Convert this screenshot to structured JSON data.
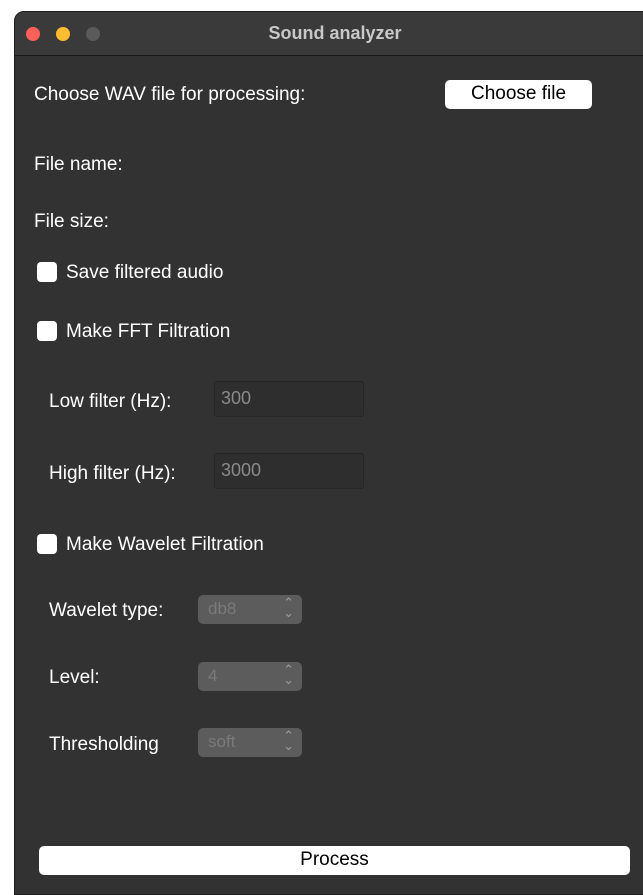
{
  "window": {
    "title": "Sound analyzer"
  },
  "file": {
    "choose_label": "Choose WAV file for processing:",
    "choose_button": "Choose file",
    "name_label": "File name:",
    "size_label": "File size:"
  },
  "options": {
    "save_filtered_label": "Save filtered audio",
    "save_filtered_checked": false,
    "fft_label": "Make FFT Filtration",
    "fft_checked": false
  },
  "fft": {
    "low_label": "Low filter (Hz):",
    "low_value": "300",
    "high_label": "High filter (Hz):",
    "high_value": "3000"
  },
  "wavelet": {
    "checkbox_label": "Make Wavelet Filtration",
    "checked": false,
    "type_label": "Wavelet type:",
    "type_value": "db8",
    "level_label": "Level:",
    "level_value": "4",
    "threshold_label": "Thresholding",
    "threshold_value": "soft"
  },
  "actions": {
    "process_label": "Process"
  },
  "colors": {
    "window_bg": "#323232",
    "close": "#fe5f57",
    "minimize": "#febc2e",
    "maximize_disabled": "#5a5a5a"
  }
}
